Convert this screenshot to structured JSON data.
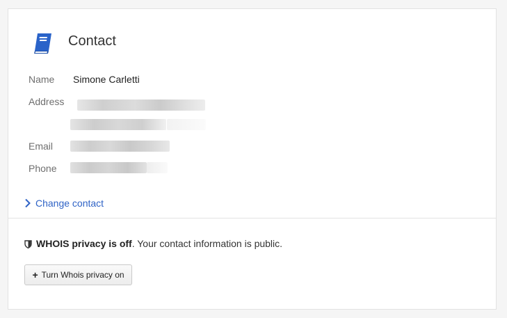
{
  "contact": {
    "title": "Contact",
    "icon": "address-book-icon",
    "fields": {
      "name_label": "Name",
      "name_value": "Simone Carletti",
      "address_label": "Address",
      "email_label": "Email",
      "phone_label": "Phone"
    },
    "change_link": "Change contact"
  },
  "privacy": {
    "status_strong": "WHOIS privacy is off",
    "status_rest": ". Your contact information is public.",
    "button_label": "Turn Whois privacy on"
  },
  "colors": {
    "accent": "#2f63c6",
    "icon_blue": "#2a63c9"
  }
}
